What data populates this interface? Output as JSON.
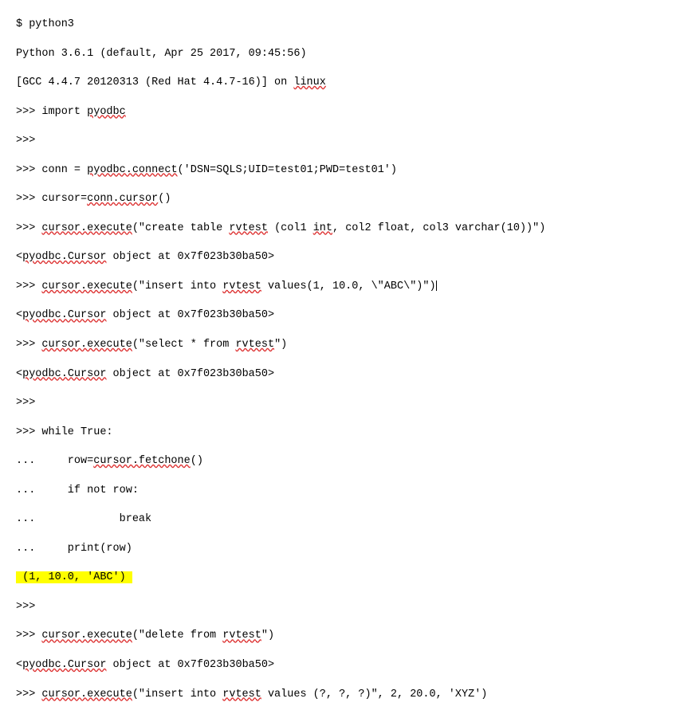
{
  "lines": [
    {
      "segments": [
        {
          "t": "$ python3"
        }
      ]
    },
    {
      "segments": [
        {
          "t": "Python 3.6.1 (default, Apr 25 2017, 09:45:56)"
        }
      ]
    },
    {
      "segments": [
        {
          "t": "[GCC 4.4.7 20120313 (Red Hat 4.4.7-16)] on "
        },
        {
          "t": "linux",
          "sq": true
        }
      ]
    },
    {
      "segments": [
        {
          "t": ">>> import "
        },
        {
          "t": "pyodbc",
          "sq": true
        }
      ]
    },
    {
      "segments": [
        {
          "t": ">>>"
        }
      ]
    },
    {
      "segments": [
        {
          "t": ">>> conn = "
        },
        {
          "t": "pyodbc.connect",
          "sq": true
        },
        {
          "t": "('DSN=SQLS;UID=test01;PWD=test01')"
        }
      ]
    },
    {
      "segments": [
        {
          "t": ">>> cursor="
        },
        {
          "t": "conn.cursor",
          "sq": true
        },
        {
          "t": "()"
        }
      ]
    },
    {
      "segments": [
        {
          "t": ">>> "
        },
        {
          "t": "cursor.execute",
          "sq": true
        },
        {
          "t": "(\"create table "
        },
        {
          "t": "rvtest",
          "sq": true
        },
        {
          "t": " (col1 "
        },
        {
          "t": "int",
          "sq": true
        },
        {
          "t": ", col2 float, col3 varchar(10))\")"
        }
      ]
    },
    {
      "segments": [
        {
          "t": "<"
        },
        {
          "t": "pyodbc.Cursor",
          "sq": true
        },
        {
          "t": " object at 0x7f023b30ba50>"
        }
      ]
    },
    {
      "segments": [
        {
          "t": ">>> "
        },
        {
          "t": "cursor.execute",
          "sq": true
        },
        {
          "t": "(\"insert into "
        },
        {
          "t": "rvtest",
          "sq": true
        },
        {
          "t": " values(1, 10.0, \\\"ABC\\\")\")"
        },
        {
          "cursor": true
        }
      ]
    },
    {
      "segments": [
        {
          "t": "<"
        },
        {
          "t": "pyodbc.Cursor",
          "sq": true
        },
        {
          "t": " object at 0x7f023b30ba50>"
        }
      ]
    },
    {
      "segments": [
        {
          "t": ">>> "
        },
        {
          "t": "cursor.execute",
          "sq": true
        },
        {
          "t": "(\"select * from "
        },
        {
          "t": "rvtest",
          "sq": true
        },
        {
          "t": "\")"
        }
      ]
    },
    {
      "segments": [
        {
          "t": "<"
        },
        {
          "t": "pyodbc.Cursor",
          "sq": true
        },
        {
          "t": " object at 0x7f023b30ba50>"
        }
      ]
    },
    {
      "segments": [
        {
          "t": ">>>"
        }
      ]
    },
    {
      "segments": [
        {
          "t": ">>> while True:"
        }
      ]
    },
    {
      "segments": [
        {
          "t": "...     row="
        },
        {
          "t": "cursor.fetchone",
          "sq": true
        },
        {
          "t": "()"
        }
      ]
    },
    {
      "segments": [
        {
          "t": "...     if not row:"
        }
      ]
    },
    {
      "segments": [
        {
          "t": "...             break"
        }
      ]
    },
    {
      "segments": [
        {
          "t": "...     print(row)"
        }
      ]
    },
    {
      "segments": [
        {
          "t": " (1, 10.0, 'ABC') ",
          "hl": true
        }
      ]
    },
    {
      "segments": [
        {
          "t": ">>>"
        }
      ]
    },
    {
      "segments": [
        {
          "t": ">>> "
        },
        {
          "t": "cursor.execute",
          "sq": true
        },
        {
          "t": "(\"delete from "
        },
        {
          "t": "rvtest",
          "sq": true
        },
        {
          "t": "\")"
        }
      ]
    },
    {
      "segments": [
        {
          "t": "<"
        },
        {
          "t": "pyodbc.Cursor",
          "sq": true
        },
        {
          "t": " object at 0x7f023b30ba50>"
        }
      ]
    },
    {
      "segments": [
        {
          "t": ">>> "
        },
        {
          "t": "cursor.execute",
          "sq": true
        },
        {
          "t": "(\"insert into "
        },
        {
          "t": "rvtest",
          "sq": true
        },
        {
          "t": " values (?, ?, ?)\", 2, 20.0, 'XYZ')"
        }
      ]
    }
  ]
}
